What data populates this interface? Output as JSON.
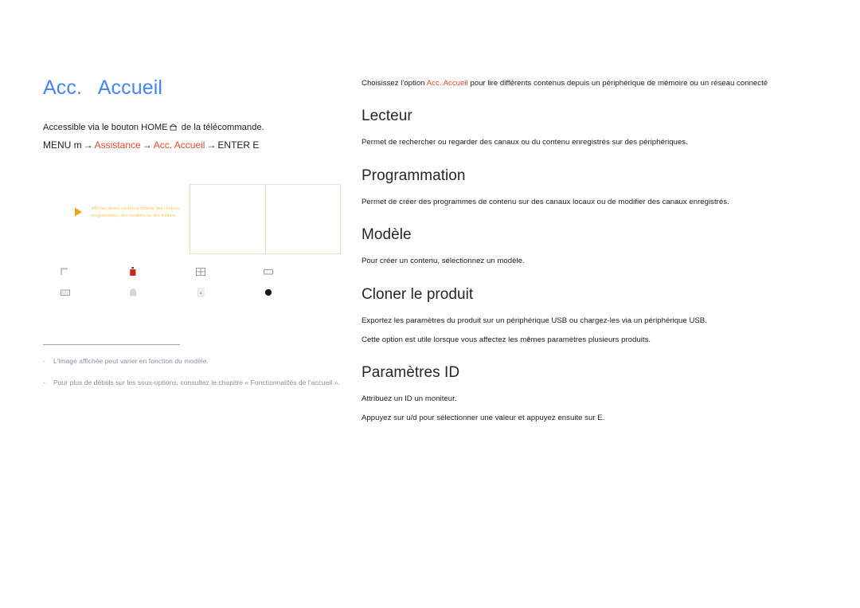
{
  "left": {
    "page_title": "Acc.   Accueil",
    "access_prefix": "Accessible via le bouton HOME",
    "home_icon": "home-icon",
    "access_suffix": " de la télécommande.",
    "menu_path": {
      "menu_label": "MENU m",
      "arrow": "→",
      "item1": "Assistance",
      "item2": "Acc.   Accueil",
      "enter_label": "ENTER E"
    },
    "illustration": {
      "callout_arrow_icon": "play-arrow-icon",
      "callout_text": "Affichez divers contenus comme des chaînes programmées, des modèles ou des fichiers.",
      "panes": [
        "mock-pane-left",
        "mock-pane-right"
      ],
      "icons": [
        "cursor-icon",
        "device-red-icon",
        "grid-four-icon",
        "rectangle-icon",
        "display-icon",
        "rounded-square-icon",
        "document-icon",
        "filled-circle-icon"
      ]
    },
    "notes": [
      {
        "dash": "-",
        "text": "L'image affichée peut varier en fonction du modèle."
      },
      {
        "dash": "-",
        "text": "Pour plus de détails sur les sous-options, consultez le chapitre « Fonctionnalités de l'accueil »."
      }
    ]
  },
  "right": {
    "intro": {
      "before": "Choisissez l'option ",
      "accent": "Acc.   Accueil",
      "after": " pour lire différents contenus depuis un périphérique de mémoire ou un réseau connecté"
    },
    "sections": [
      {
        "title": "Lecteur",
        "paragraphs": [
          "Permet de rechercher ou regarder des canaux ou du contenu enregistrés sur des périphériques."
        ]
      },
      {
        "title": "Programmation",
        "paragraphs": [
          "Permet de créer des programmes de contenu sur des canaux locaux ou de modifier des canaux enregistrés."
        ]
      },
      {
        "title": "Modèle",
        "paragraphs": [
          "Pour créer un contenu, sélectionnez un modèle."
        ]
      },
      {
        "title": "Cloner le produit",
        "paragraphs": [
          "Exportez les paramètres du produit sur un périphérique USB ou chargez-les via un périphérique USB.",
          "Cette option est utile lorsque vous affectez les mêmes paramètres   plusieurs produits."
        ]
      },
      {
        "title": "Paramètres ID",
        "paragraphs": [
          "Attribuez un ID   un moniteur.",
          "Appuyez sur u/d pour sélectionner une valeur et appuyez ensuite sur    E."
        ]
      }
    ]
  },
  "colors": {
    "title_blue": "#4285f4",
    "accent_red": "#e8492c",
    "note_gray": "#8791ab",
    "callout_yellow": "#fbcb52",
    "heading_dark": "#262626"
  }
}
